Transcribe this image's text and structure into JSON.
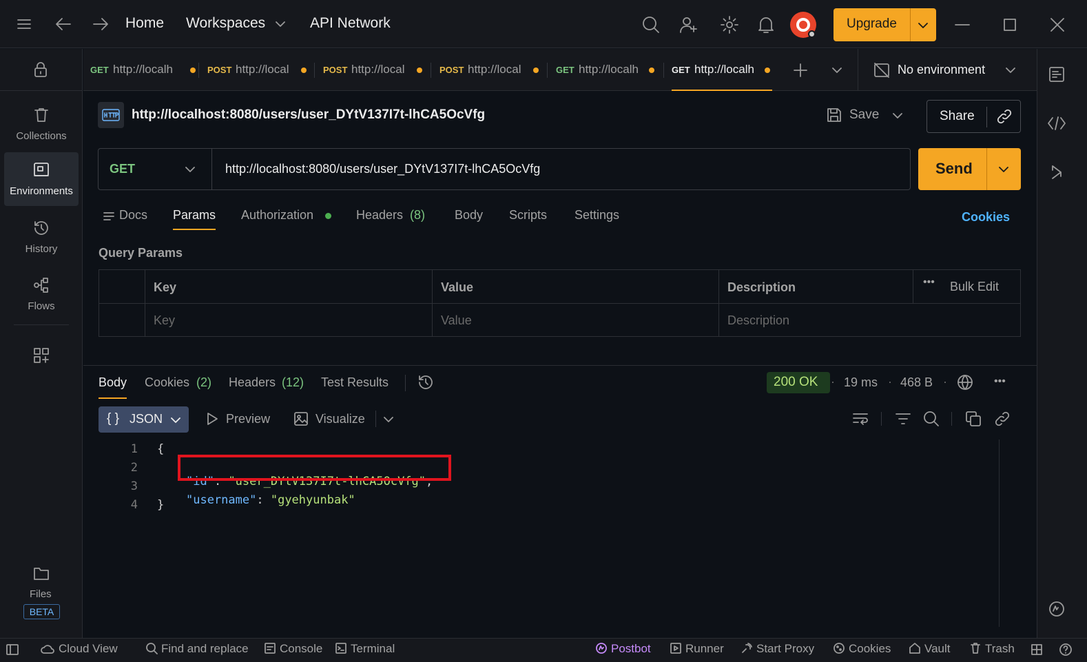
{
  "titlebar": {
    "home": "Home",
    "workspaces": "Workspaces",
    "api_network": "API Network",
    "upgrade": "Upgrade"
  },
  "sidebar": {
    "items": [
      {
        "label": "Collections"
      },
      {
        "label": "Environments"
      },
      {
        "label": "History"
      },
      {
        "label": "Flows"
      }
    ],
    "files": "Files",
    "beta": "BETA"
  },
  "tabs": [
    {
      "method": "GET",
      "url": "http://localh"
    },
    {
      "method": "POST",
      "url": "http://local"
    },
    {
      "method": "POST",
      "url": "http://local"
    },
    {
      "method": "POST",
      "url": "http://local"
    },
    {
      "method": "GET",
      "url": "http://localh"
    },
    {
      "method": "GET",
      "url": "http://localh"
    }
  ],
  "environment": "No environment",
  "request": {
    "title": "http://localhost:8080/users/user_DYtV137I7t-lhCA5OcVfg",
    "save": "Save",
    "share": "Share",
    "method": "GET",
    "url": "http://localhost:8080/users/user_DYtV137I7t-lhCA5OcVfg",
    "send": "Send"
  },
  "request_tabs": {
    "docs": "Docs",
    "params": "Params",
    "authorization": "Authorization",
    "headers": "Headers",
    "headers_count": "(8)",
    "body": "Body",
    "scripts": "Scripts",
    "settings": "Settings",
    "cookies": "Cookies"
  },
  "query_params": {
    "title": "Query Params",
    "headers": [
      "Key",
      "Value",
      "Description"
    ],
    "bulk_edit": "Bulk Edit",
    "placeholders": [
      "Key",
      "Value",
      "Description"
    ]
  },
  "response": {
    "tabs": {
      "body": "Body",
      "cookies": "Cookies",
      "cookies_count": "(2)",
      "headers": "Headers",
      "headers_count": "(12)",
      "tests": "Test Results"
    },
    "status": "200 OK",
    "time": "19 ms",
    "size": "468 B",
    "format": "JSON",
    "preview": "Preview",
    "visualize": "Visualize",
    "lines": [
      "1",
      "2",
      "3",
      "4"
    ],
    "json": {
      "open": "{",
      "id_key": "\"id\"",
      "id_value": "\"user_DYtV137I7t-lhCA5OcVfg\"",
      "username_key": "\"username\"",
      "username_value": "\"gyehyunbak\"",
      "close": "}"
    }
  },
  "statusbar": {
    "cloud_view": "Cloud View",
    "find_replace": "Find and replace",
    "console": "Console",
    "terminal": "Terminal",
    "postbot": "Postbot",
    "runner": "Runner",
    "start_proxy": "Start Proxy",
    "cookies": "Cookies",
    "vault": "Vault",
    "trash": "Trash"
  },
  "colors": {
    "accent": "#f5a623",
    "get": "#7bc47f",
    "post": "#e5b94a",
    "highlight_box": "#e0141e",
    "json_key": "#6fb8ff",
    "json_string": "#b5e07a"
  }
}
